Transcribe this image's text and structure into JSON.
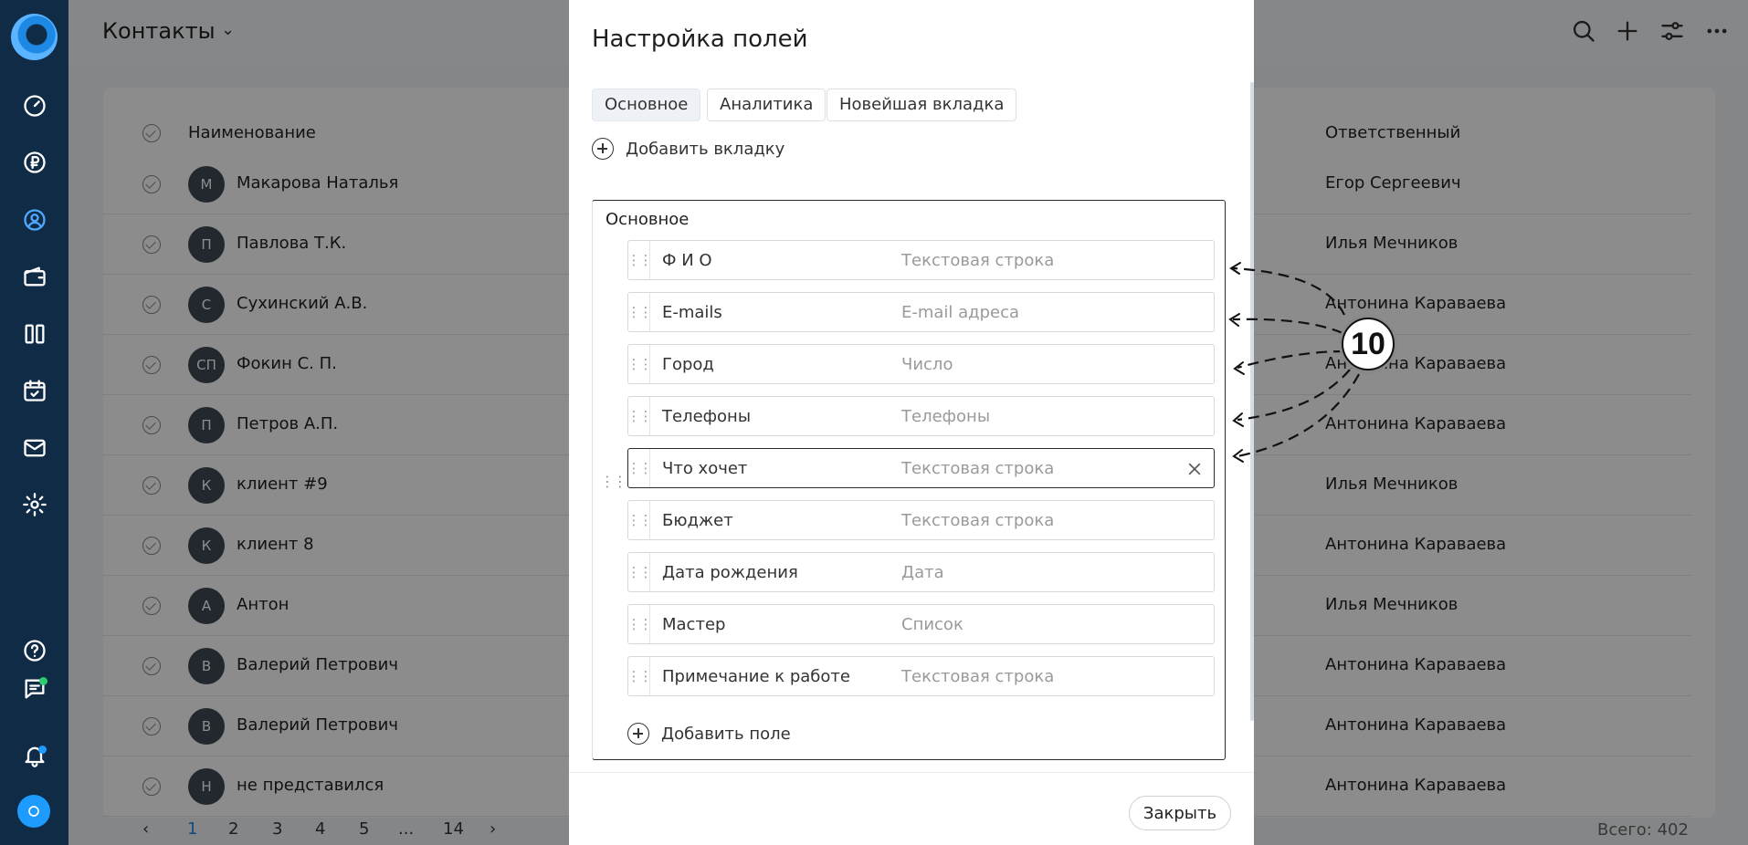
{
  "app": {
    "page_title": "Контакты",
    "colors": {
      "sidebar": "#0f2b45",
      "accent": "#1e9bff"
    }
  },
  "sidebar": {
    "items": [
      {
        "icon": "logo-icon"
      },
      {
        "icon": "dashboard-gauge-icon"
      },
      {
        "icon": "ruble-icon"
      },
      {
        "icon": "contacts-user-icon",
        "active": true
      },
      {
        "icon": "wallet-icon"
      },
      {
        "icon": "kanban-columns-icon"
      },
      {
        "icon": "calendar-check-icon"
      },
      {
        "icon": "mail-icon"
      },
      {
        "icon": "gear-icon"
      },
      {
        "icon": "help-icon"
      },
      {
        "icon": "chat-icon"
      },
      {
        "icon": "bell-icon"
      },
      {
        "icon": "support-button-icon"
      }
    ]
  },
  "header": {
    "actions": [
      "search-icon",
      "add-icon",
      "filter-sliders-icon",
      "more-icon"
    ]
  },
  "table": {
    "columns": {
      "name": "Наименование",
      "responsible": "Ответственный"
    },
    "rows": [
      {
        "initials": "М",
        "name": "Макарова Наталья",
        "responsible": "Егор Сергеевич"
      },
      {
        "initials": "П",
        "name": "Павлова Т.К.",
        "responsible": "Илья Мечников"
      },
      {
        "initials": "С",
        "name": "Сухинский А.В.",
        "responsible": "Антонина Караваева"
      },
      {
        "initials": "СП",
        "name": "Фокин С. П.",
        "responsible": "Антонина Караваева"
      },
      {
        "initials": "П",
        "name": "Петров А.П.",
        "responsible": "Антонина Караваева"
      },
      {
        "initials": "К",
        "name": "клиент #9",
        "responsible": "Илья Мечников"
      },
      {
        "initials": "К",
        "name": "клиент 8",
        "responsible": "Антонина Караваева"
      },
      {
        "initials": "А",
        "name": "Антон",
        "responsible": "Илья Мечников"
      },
      {
        "initials": "В",
        "name": "Валерий Петрович",
        "responsible": "Антонина Караваева"
      },
      {
        "initials": "В",
        "name": "Валерий Петрович",
        "responsible": "Антонина Караваева"
      },
      {
        "initials": "Н",
        "name": "не представился",
        "responsible": "Антонина Караваева"
      }
    ],
    "pagination": {
      "prev": "‹",
      "pages": [
        "1",
        "2",
        "3",
        "4",
        "5",
        "...",
        "14"
      ],
      "next": "›",
      "current": "1"
    },
    "total": "Всего: 402"
  },
  "modal": {
    "title": "Настройка полей",
    "tabs": [
      "Основное",
      "Аналитика",
      "Новейшая вкладка"
    ],
    "add_tab_label": "Добавить вкладку",
    "section_title": "Основное",
    "fields": [
      {
        "name": "Ф И О",
        "type": "Текстовая строка"
      },
      {
        "name": "E-mails",
        "type": "E-mail адреса"
      },
      {
        "name": "Город",
        "type": "Число"
      },
      {
        "name": "Телефоны",
        "type": "Телефоны"
      },
      {
        "name": "Что хочет",
        "type": "Текстовая строка",
        "selected": true
      },
      {
        "name": "Бюджет",
        "type": "Текстовая строка"
      },
      {
        "name": "Дата рождения",
        "type": "Дата"
      },
      {
        "name": "Мастер",
        "type": "Список"
      },
      {
        "name": "Примечание к работе",
        "type": "Текстовая строка"
      }
    ],
    "add_field_label": "Добавить поле",
    "close_label": "Закрыть"
  },
  "annotation": {
    "badge": "10"
  }
}
